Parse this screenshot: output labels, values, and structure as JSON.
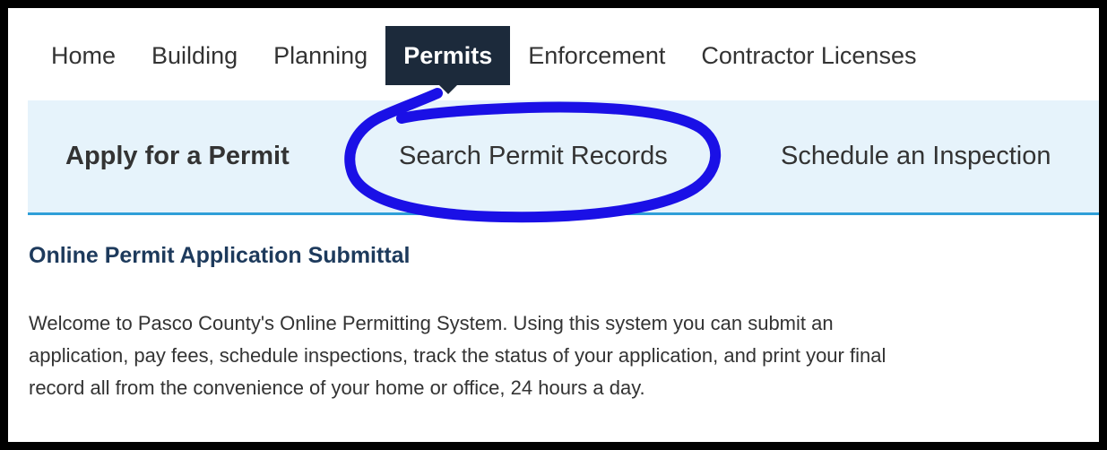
{
  "top_nav": {
    "items": [
      {
        "label": "Home"
      },
      {
        "label": "Building"
      },
      {
        "label": "Planning"
      },
      {
        "label": "Permits",
        "active": true
      },
      {
        "label": "Enforcement"
      },
      {
        "label": "Contractor Licenses"
      }
    ]
  },
  "sub_nav": {
    "apply": "Apply for a Permit",
    "search": "Search Permit Records",
    "schedule": "Schedule an Inspection"
  },
  "content": {
    "title": "Online Permit Application Submittal",
    "body": "Welcome to Pasco County's Online Permitting System. Using this system you can submit an application, pay fees, schedule inspections, track the status of your application, and print your final record all from the convenience of your home or office, 24 hours a day."
  },
  "colors": {
    "active_nav_bg": "#1c2a3b",
    "subnav_bg": "#e6f3fb",
    "subnav_border": "#2f9fd8",
    "title_color": "#1d3a5c",
    "annotation_color": "#1a10e6"
  }
}
